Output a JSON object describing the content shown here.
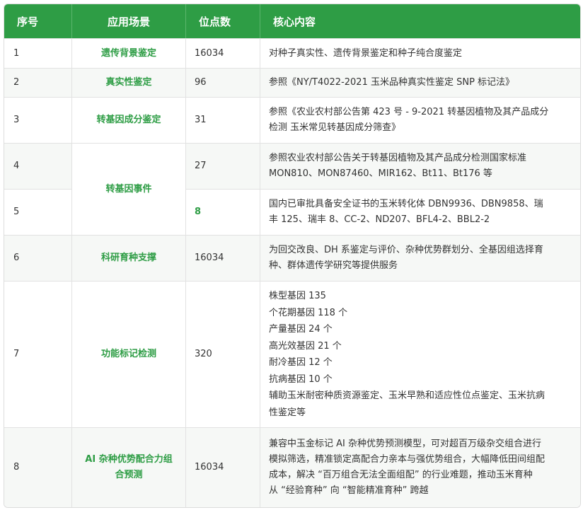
{
  "header": {
    "col1": "序号",
    "col2": "应用场景",
    "col3": "位点数",
    "col4": "核心内容"
  },
  "rows": {
    "r1": {
      "idx": "1",
      "scene": "遗传背景鉴定",
      "num": "16034",
      "content": [
        "对种子真实性、遗传背景鉴定和种子纯合度鉴定"
      ]
    },
    "r2": {
      "idx": "2",
      "scene": "真实性鉴定",
      "num": "96",
      "content": [
        "参照《NY/T4022-2021 玉米品种真实性鉴定 SNP 标记法》"
      ]
    },
    "r3": {
      "idx": "3",
      "scene": "转基因成分鉴定",
      "num": "31",
      "content": [
        "参照《农业农村部公告第 423 号 - 9-2021 转基因植物及其产品成分",
        "检测 玉米常见转基因成分筛查》"
      ]
    },
    "r4": {
      "idx": "4",
      "scene": "转基因事件",
      "num": "27",
      "content": [
        "参照农业农村部公告关于转基因植物及其产品成分检测国家标准",
        "MON810、MON87460、MIR162、Bt11、Bt176 等"
      ]
    },
    "r5": {
      "idx": "5",
      "num": "8",
      "content": [
        "国内已审批具备安全证书的玉米转化体 DBN9936、DBN9858、瑞",
        "丰 125、瑞丰 8、CC-2、ND207、BFL4-2、BBL2-2"
      ]
    },
    "r6": {
      "idx": "6",
      "scene": "科研育种支撑",
      "num": "16034",
      "content": [
        "为回交改良、DH 系鉴定与评价、杂种优势群划分、全基因组选择育",
        "种、群体遗传学研究等提供服务"
      ]
    },
    "r7": {
      "idx": "7",
      "scene": "功能标记检测",
      "num": "320",
      "content": [
        "株型基因 135",
        "个花期基因 118 个",
        "产量基因 24 个",
        "高光效基因 21 个",
        "耐冷基因 12 个",
        "抗病基因 10 个",
        "辅助玉米耐密种质资源鉴定、玉米早熟和适应性位点鉴定、玉米抗病",
        "性鉴定等"
      ]
    },
    "r8": {
      "idx": "8",
      "scene_lines": [
        "AI 杂种优势配合力组",
        "合预测"
      ],
      "num": "16034",
      "content": [
        "兼容中玉金标记 AI 杂种优势预测模型，可对超百万级杂交组合进行",
        "模拟筛选，精准锁定高配合力亲本与强优势组合，大幅降低田间组配",
        "成本，解决 “百万组合无法全面组配” 的行业难题，推动玉米育种",
        "从 “经验育种” 向 “智能精准育种” 跨越"
      ]
    }
  },
  "colors": {
    "header_bg": "#2e9d45",
    "accent_text": "#2e9d45",
    "zebra_bg": "#f6f8f6"
  }
}
